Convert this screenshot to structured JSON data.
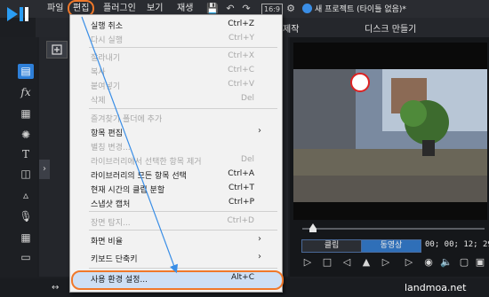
{
  "menubar": {
    "file": "파일",
    "edit": "편집",
    "plugins": "플러그인",
    "view": "보기",
    "playback": "재생",
    "ratio": "16:9",
    "project_title": "새 프로젝트 (타이틀 없음)*"
  },
  "tabs": {
    "produce": "제작",
    "disc": "디스크 만들기"
  },
  "edit_menu": {
    "items": [
      {
        "label": "실행 취소",
        "shortcut": "Ctrl+Z",
        "disabled": false
      },
      {
        "label": "다시 실행",
        "shortcut": "Ctrl+Y",
        "disabled": true
      },
      {
        "label": "잘라내기",
        "shortcut": "Ctrl+X",
        "disabled": true
      },
      {
        "label": "복사",
        "shortcut": "Ctrl+C",
        "disabled": true
      },
      {
        "label": "붙여넣기",
        "shortcut": "Ctrl+V",
        "disabled": true
      },
      {
        "label": "삭제",
        "shortcut": "Del",
        "disabled": true
      },
      {
        "label": "즐겨찾기 폴더에 추가",
        "shortcut": "",
        "disabled": true
      },
      {
        "label": "항목 편집",
        "shortcut": "",
        "disabled": false,
        "submenu": true
      },
      {
        "label": "별칭 변경...",
        "shortcut": "",
        "disabled": true
      },
      {
        "label": "라이브러리에서 선택한 항목 제거",
        "shortcut": "Del",
        "disabled": true
      },
      {
        "label": "라이브러리의 모든 항목 선택",
        "shortcut": "Ctrl+A",
        "disabled": false
      },
      {
        "label": "현재 시간의 클립 분할",
        "shortcut": "Ctrl+T",
        "disabled": false
      },
      {
        "label": "스냅샷 캡처",
        "shortcut": "Ctrl+P",
        "disabled": false
      },
      {
        "label": "장면 탐지...",
        "shortcut": "Ctrl+D",
        "disabled": true
      },
      {
        "label": "화면 비율",
        "shortcut": "",
        "disabled": false,
        "submenu": true
      },
      {
        "label": "키보드 단축키",
        "shortcut": "",
        "disabled": false,
        "submenu": true
      },
      {
        "label": "사용 환경 설정...",
        "shortcut": "Alt+C",
        "disabled": false
      }
    ]
  },
  "preview": {
    "clip_label": "클립",
    "video_label": "동영상",
    "timecode": "00; 00; 12; 29"
  },
  "icons": {
    "logo": "powerdirector-logo",
    "save": "save-icon",
    "undo": "undo-icon",
    "redo": "redo-icon",
    "settings": "gear-icon",
    "account": "account-icon"
  },
  "colors": {
    "highlight": "#f0782a",
    "accent": "#2e7fd8",
    "arrow": "#3a8ee6"
  },
  "watermark": "landmoa.net"
}
